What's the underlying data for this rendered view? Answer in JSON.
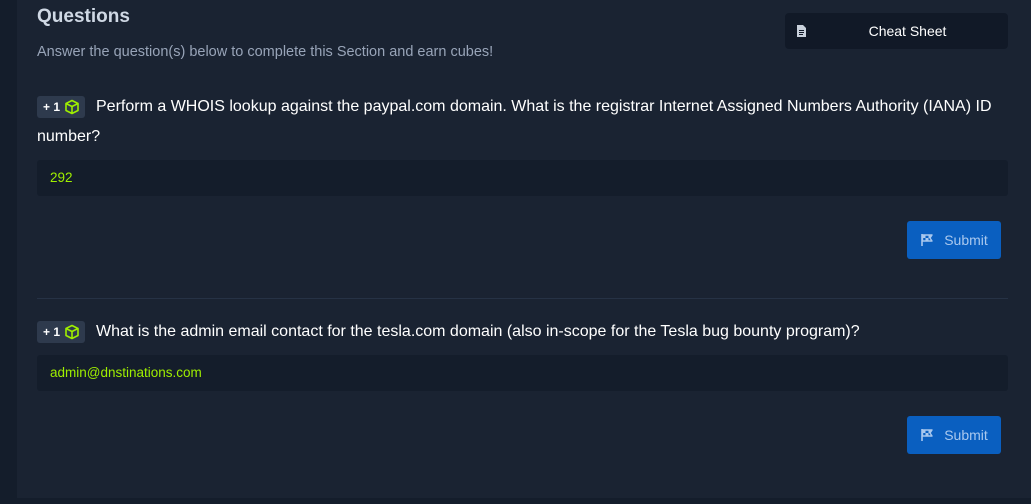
{
  "section": {
    "title": "Questions",
    "subtitle": "Answer the question(s) below to complete this Section and earn cubes!",
    "cheat_sheet_label": "Cheat Sheet"
  },
  "questions": [
    {
      "badge": "+ 1",
      "text": "Perform a WHOIS lookup against the paypal.com domain. What is the registrar Internet Assigned Numbers Authority (IANA) ID number?",
      "answer": "292",
      "submit_label": "Submit"
    },
    {
      "badge": "+ 1",
      "text": "What is the admin email contact for the tesla.com domain (also in-scope for the Tesla bug bounty program)?",
      "answer": "admin@dnstinations.com",
      "submit_label": "Submit"
    }
  ],
  "colors": {
    "page_bg": "#141d2b",
    "panel_bg": "#1a2332",
    "answer_text": "#9fef00",
    "submit_bg": "#0a5fc0",
    "cube_icon": "#9fef00"
  },
  "icons": {
    "cheat_sheet": "document-icon",
    "badge": "cube-icon",
    "submit": "flag-icon"
  }
}
